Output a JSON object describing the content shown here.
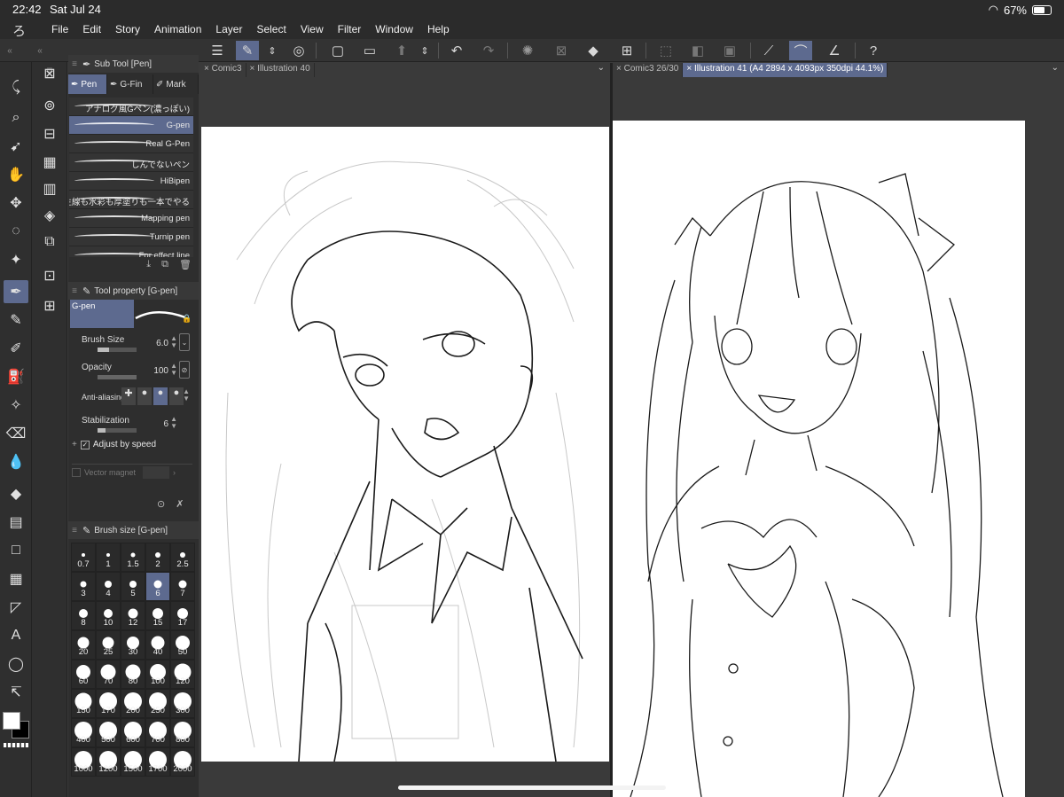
{
  "status": {
    "time": "22:42",
    "date": "Sat Jul 24",
    "battery": "67%"
  },
  "menu": {
    "items": [
      "File",
      "Edit",
      "Story",
      "Animation",
      "Layer",
      "Select",
      "View",
      "Filter",
      "Window",
      "Help"
    ]
  },
  "subtool_panel": {
    "title": "Sub Tool [Pen]",
    "tabs": [
      "Pen",
      "G-Fin",
      "Mark"
    ],
    "brushes": [
      "アナログ風Gペン(濃っぽい)",
      "G-pen",
      "Real G-Pen",
      "しんでないペン",
      "HiBipen",
      "主線も水彩も厚塗りも一本でやる",
      "Mapping pen",
      "Turnip pen",
      "For effect line"
    ]
  },
  "tool_property": {
    "title": "Tool property [G-pen]",
    "preview_label": "G-pen",
    "brush_size_label": "Brush Size",
    "brush_size_value": "6.0",
    "brush_size_fraction": 0.3,
    "opacity_label": "Opacity",
    "opacity_value": "100",
    "opacity_fraction": 1.0,
    "anti_aliasing_label": "Anti-aliasing",
    "stabilization_label": "Stabilization",
    "stabilization_value": "6",
    "stabilization_fraction": 0.2,
    "adjust_label": "Adjust by speed",
    "vector_label": "Vector magnet"
  },
  "brush_size_panel": {
    "title": "Brush size [G-pen]",
    "sizes": [
      "0.7",
      "1",
      "1.5",
      "2",
      "2.5",
      "3",
      "4",
      "5",
      "6",
      "7",
      "8",
      "10",
      "12",
      "15",
      "17",
      "20",
      "25",
      "30",
      "40",
      "50",
      "60",
      "70",
      "80",
      "100",
      "120",
      "150",
      "170",
      "200",
      "250",
      "300",
      "400",
      "500",
      "600",
      "700",
      "800",
      "1000",
      "1200",
      "1500",
      "1700",
      "2000"
    ],
    "selected": "6"
  },
  "docs": {
    "left_tabs": [
      "Comic3",
      "Illustration 40"
    ],
    "right_tabs": [
      "Comic3   26/30",
      "Illustration 41 (A4 2894 x 4093px 350dpi 44.1%)"
    ]
  },
  "colors": {
    "accent": "#5d6a8f",
    "panel": "#2e2e2e",
    "canvas_bg": "#3a3a3a"
  }
}
